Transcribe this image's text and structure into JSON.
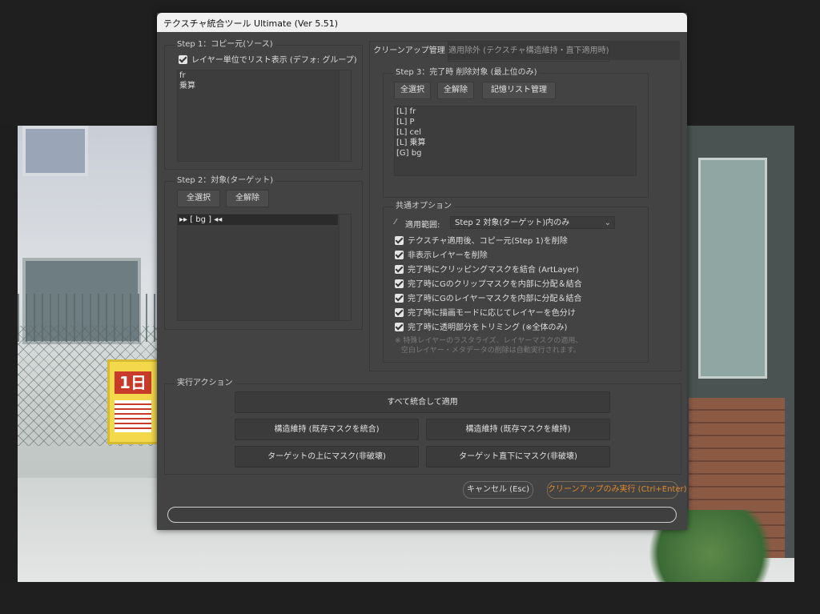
{
  "window": {
    "title": "テクスチャ統合ツール Ultimate (Ver 5.51)"
  },
  "step1": {
    "label": "Step 1：コピー元(ソース)",
    "layer_list_checkbox": "レイヤー単位でリスト表示 (デフォ: グループ)",
    "items": [
      "fr",
      "乗算"
    ]
  },
  "step2": {
    "label": "Step 2：対象(ターゲット)",
    "select_all": "全選択",
    "deselect_all": "全解除",
    "items": [
      "▸▸ [ bg ] ◂◂"
    ]
  },
  "tabs": [
    "クリーンアップ管理",
    "適用除外 (テクスチャ構造維持・直下適用時)"
  ],
  "step3": {
    "label": "Step 3：完了時 削除対象 (最上位のみ)",
    "select_all": "全選択",
    "deselect_all": "全解除",
    "memory_list": "記憶リスト管理",
    "items": [
      "[L] fr",
      "[L] P",
      "[L] cel",
      "[L] 乗算",
      "[G] bg"
    ]
  },
  "common": {
    "label": "共通オプション",
    "scope_label": "適用範囲:",
    "scope_value": "Step 2 対象(ターゲット)内のみ",
    "options": [
      "テクスチャ適用後、コピー元(Step 1)を削除",
      "非表示レイヤーを削除",
      "完了時にクリッピングマスクを結合 (ArtLayer)",
      "完了時にGのクリップマスクを内部に分配＆結合",
      "完了時にGのレイヤーマスクを内部に分配＆結合",
      "完了時に描画モードに応じてレイヤーを色分け",
      "完了時に透明部分をトリミング (※全体のみ)"
    ],
    "note_line1": "※ 特殊レイヤーのラスタライズ、レイヤーマスクの適用、",
    "note_line2": "空白レイヤー・メタデータの削除は自動実行されます。"
  },
  "actions": {
    "label": "実行アクション",
    "apply_all": "すべて統合して適用",
    "keep_structure_merge": "構造維持 (既存マスクを統合)",
    "keep_structure_keep": "構造維持 (既存マスクを維持)",
    "mask_above": "ターゲットの上にマスク(非破壊)",
    "mask_below": "ターゲット直下にマスク(非破壊)"
  },
  "footer": {
    "cancel": "キャンセル (Esc)",
    "cleanup_only": "クリーンアップのみ実行 (Ctrl+Enter)"
  },
  "colors": {
    "accent": "#e0892e",
    "dialog_bg": "#434343"
  }
}
